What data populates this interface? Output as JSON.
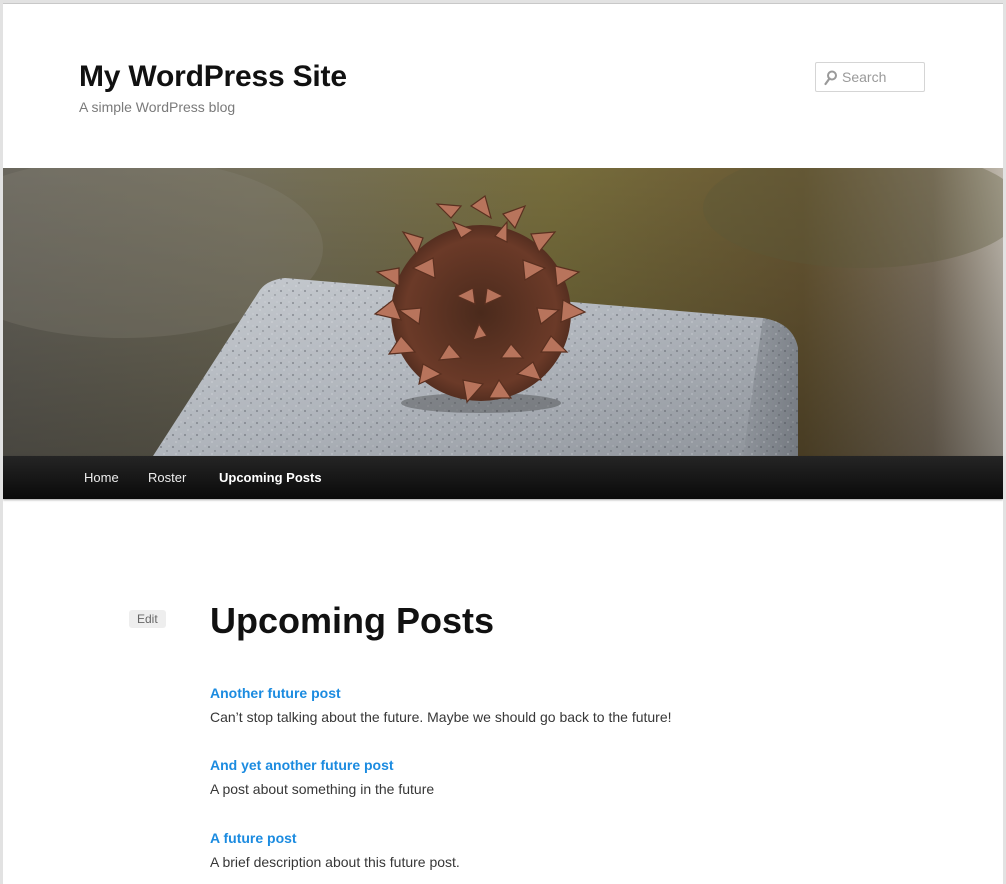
{
  "site": {
    "title": "My WordPress Site",
    "description": "A simple WordPress blog"
  },
  "search": {
    "placeholder": "Search",
    "icon": "search-icon"
  },
  "header_image": {
    "subject": "pine cone on granite block"
  },
  "nav": {
    "items": [
      {
        "label": "Home"
      },
      {
        "label": "Roster"
      },
      {
        "label": "Upcoming Posts",
        "current": true
      }
    ]
  },
  "page": {
    "edit_label": "Edit",
    "title": "Upcoming Posts",
    "posts": [
      {
        "title": "Another future post",
        "excerpt": "Can’t stop talking about the future. Maybe we should go back to the future!"
      },
      {
        "title": "And yet another future post",
        "excerpt": "A post about something in the future"
      },
      {
        "title": "A future post",
        "excerpt": "A brief description about this future post."
      }
    ]
  },
  "colors": {
    "link": "#1b8be0",
    "nav_bg": "#0a0a0a",
    "title": "#111111"
  }
}
